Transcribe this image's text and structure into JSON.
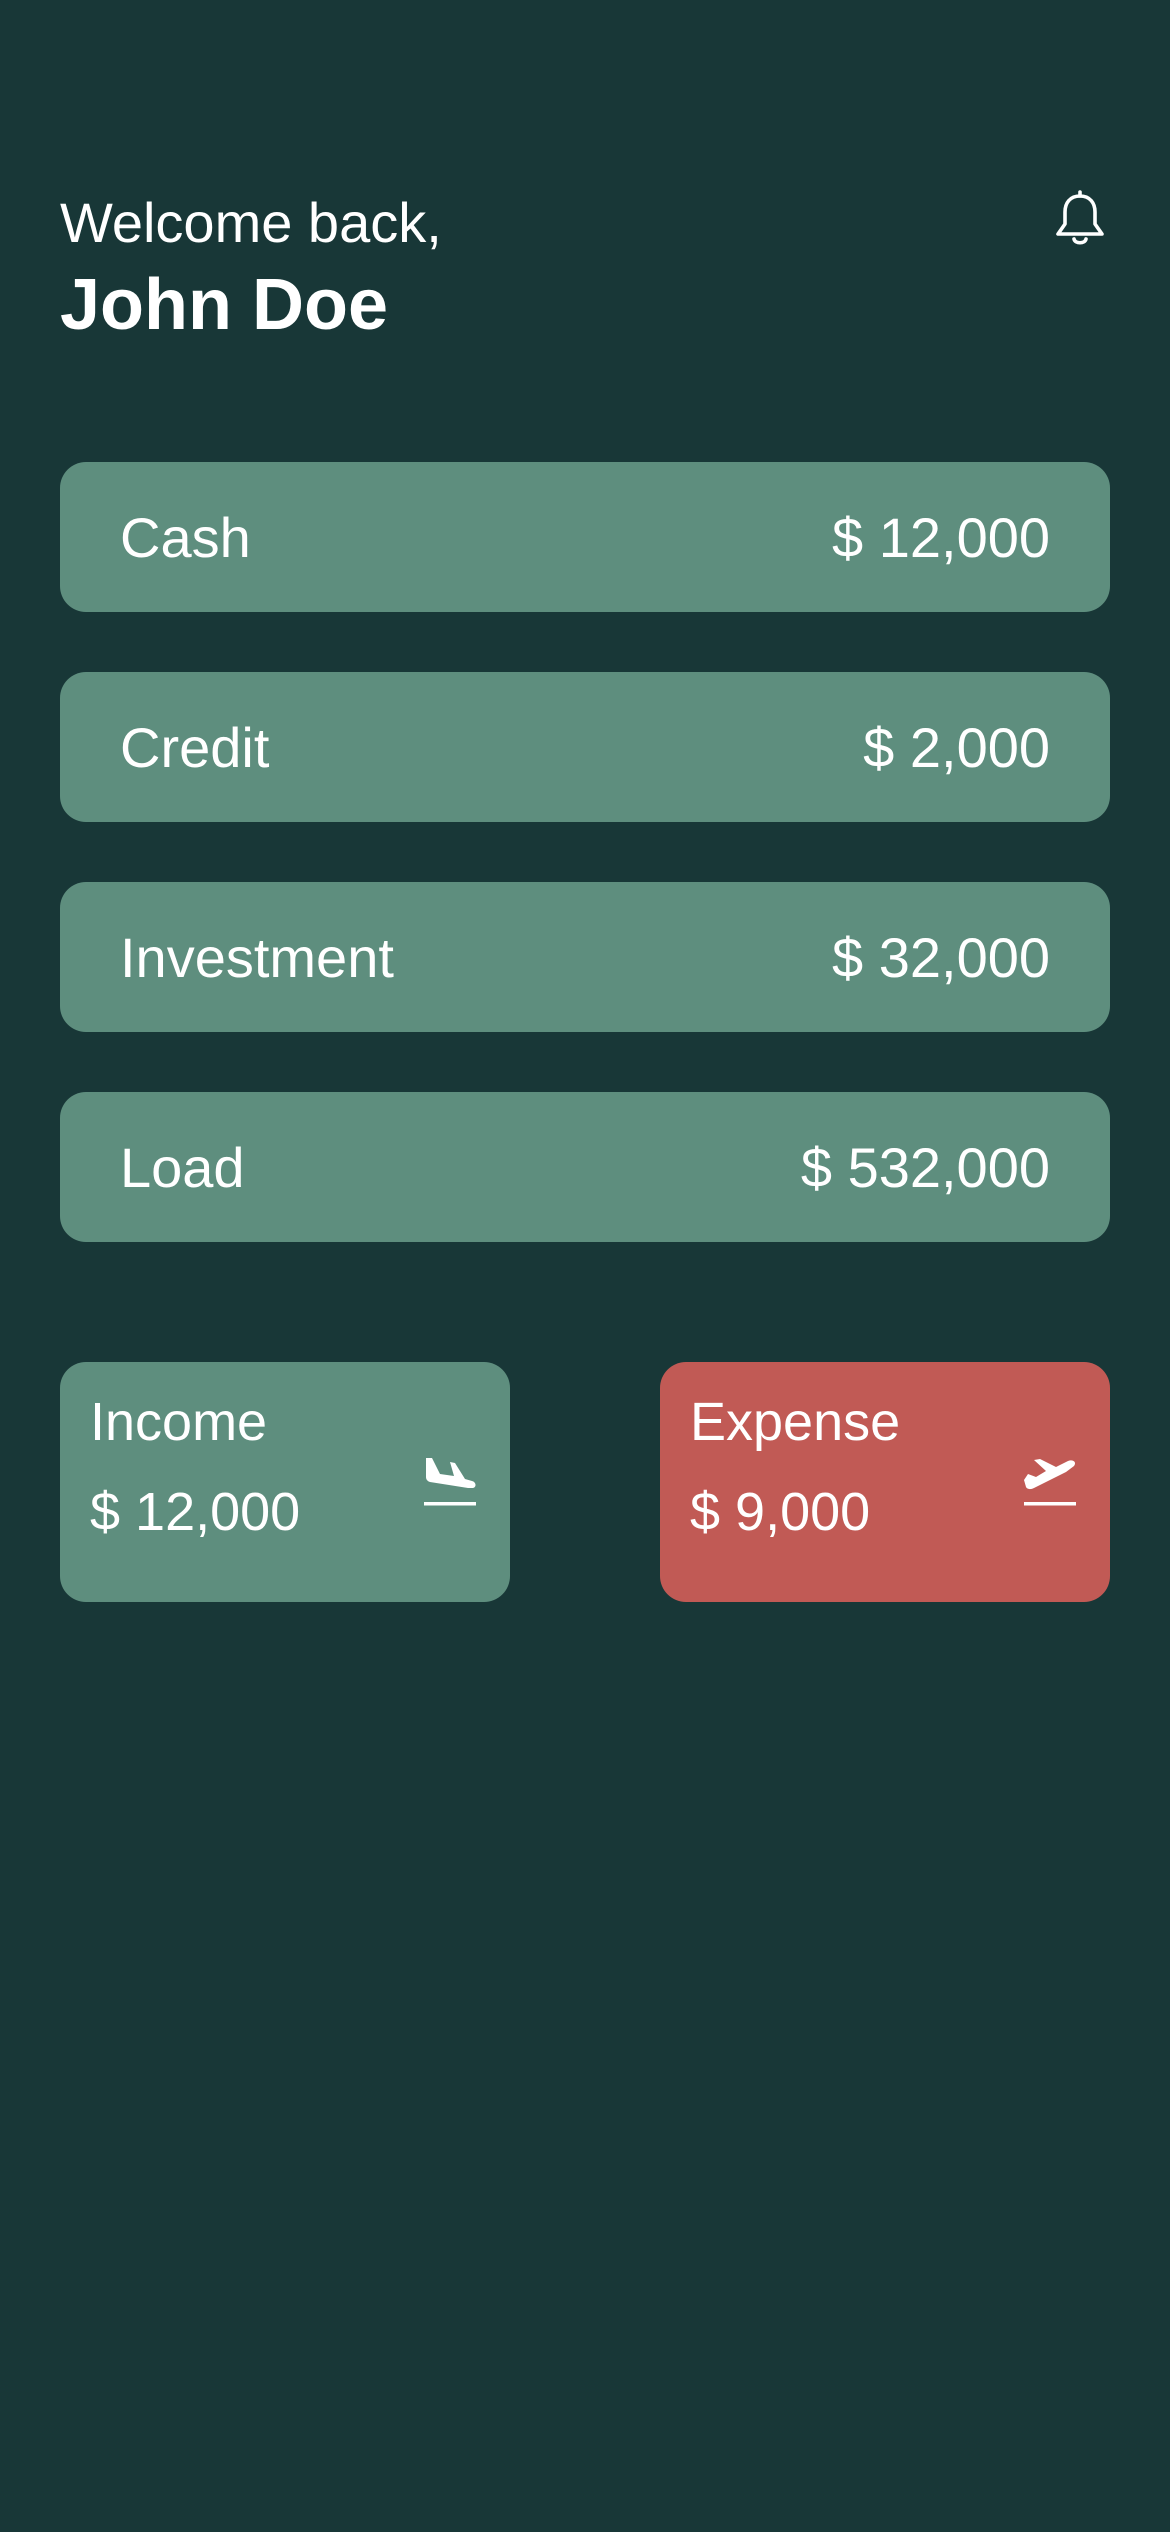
{
  "header": {
    "greeting": "Welcome back,",
    "username": "John Doe",
    "notification_icon": "bell-icon"
  },
  "accounts": [
    {
      "label": "Cash",
      "amount": "$ 12,000"
    },
    {
      "label": "Credit",
      "amount": "$ 2,000"
    },
    {
      "label": "Investment",
      "amount": "$ 32,000"
    },
    {
      "label": "Load",
      "amount": "$ 532,000"
    }
  ],
  "summary": {
    "income": {
      "label": "Income",
      "amount": "$ 12,000",
      "icon": "plane-landing-icon",
      "color": "#5e8e7e"
    },
    "expense": {
      "label": "Expense",
      "amount": "$ 9,000",
      "icon": "plane-departure-icon",
      "color": "#c15a55"
    }
  },
  "colors": {
    "background": "#183737",
    "card": "#5e8e7e",
    "expense": "#c15a55",
    "text": "#ffffff"
  }
}
